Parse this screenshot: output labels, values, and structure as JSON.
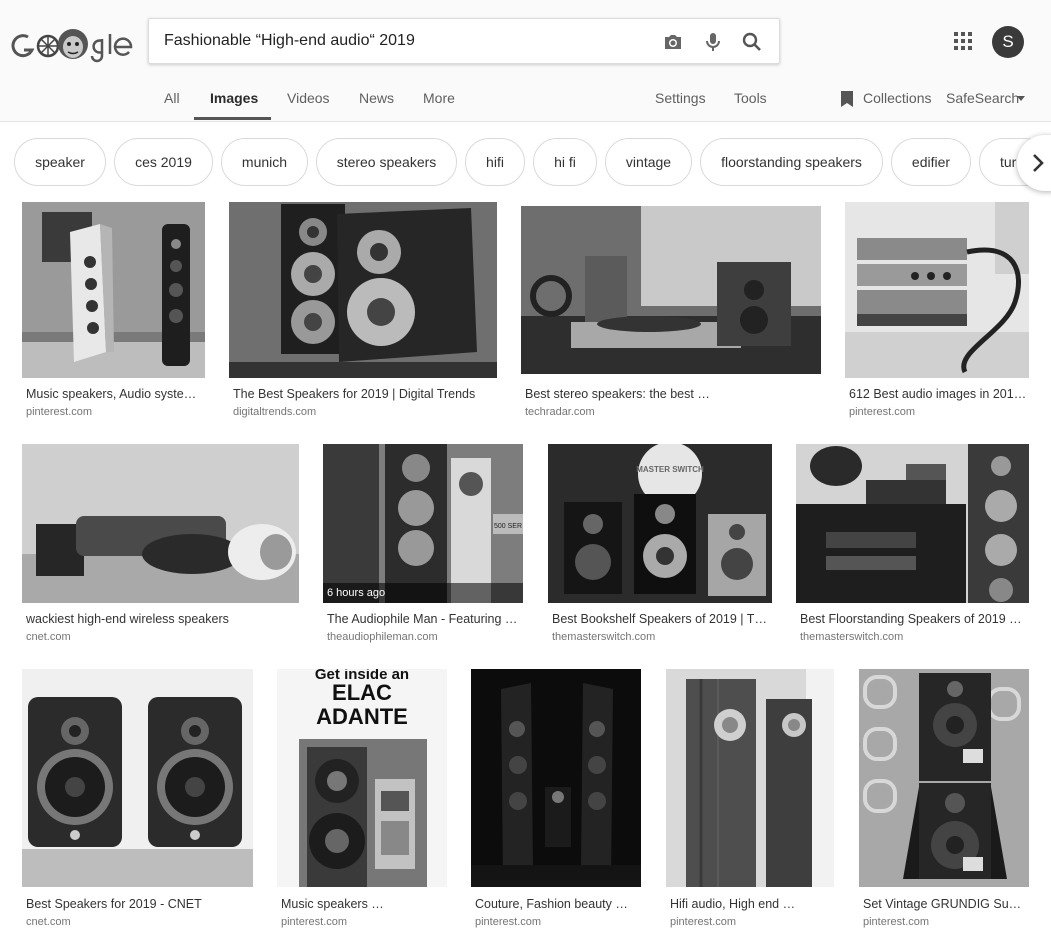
{
  "search": {
    "query": "Fashionable “High-end audio“ 2019"
  },
  "account": {
    "initial": "S"
  },
  "nav": {
    "all": "All",
    "images": "Images",
    "videos": "Videos",
    "news": "News",
    "more": "More",
    "settings": "Settings",
    "tools": "Tools",
    "collections": "Collections",
    "safesearch": "SafeSearch"
  },
  "chips": [
    "speaker",
    "ces 2019",
    "munich",
    "stereo speakers",
    "hifi",
    "hi fi",
    "vintage",
    "floorstanding speakers",
    "edifier",
    "tur"
  ],
  "results": [
    {
      "caption": "Music speakers, Audio syste…",
      "domain": "pinterest.com"
    },
    {
      "caption": "The Best Speakers for 2019 | Digital Trends",
      "domain": "digitaltrends.com"
    },
    {
      "caption": "Best stereo speakers: the best …",
      "domain": "techradar.com"
    },
    {
      "caption": "612 Best audio images in 201…",
      "domain": "pinterest.com"
    },
    {
      "caption": "wackiest high-end wireless speakers",
      "domain": "cnet.com"
    },
    {
      "caption": "The Audiophile Man - Featuring …",
      "domain": "theaudiophileman.com",
      "overlay": "6 hours ago"
    },
    {
      "caption": "Best Bookshelf Speakers of 2019 | T…",
      "domain": "themasterswitch.com"
    },
    {
      "caption": "Best Floorstanding Speakers of 2019 …",
      "domain": "themasterswitch.com"
    },
    {
      "caption": "Best Speakers for 2019 - CNET",
      "domain": "cnet.com"
    },
    {
      "caption": "Music speakers …",
      "domain": "pinterest.com"
    },
    {
      "caption": "Couture, Fashion beauty …",
      "domain": "pinterest.com"
    },
    {
      "caption": "Hifi audio, High end …",
      "domain": "pinterest.com"
    },
    {
      "caption": "Set Vintage GRUNDIG Su…",
      "domain": "pinterest.com"
    }
  ],
  "thumb_text": {
    "master_switch": "MASTER SWITCH",
    "get_inside": "Get inside an",
    "elac": "ELAC",
    "adante": "ADANTE",
    "elac_badge": "ELAC",
    "series_500": "500 SER"
  }
}
